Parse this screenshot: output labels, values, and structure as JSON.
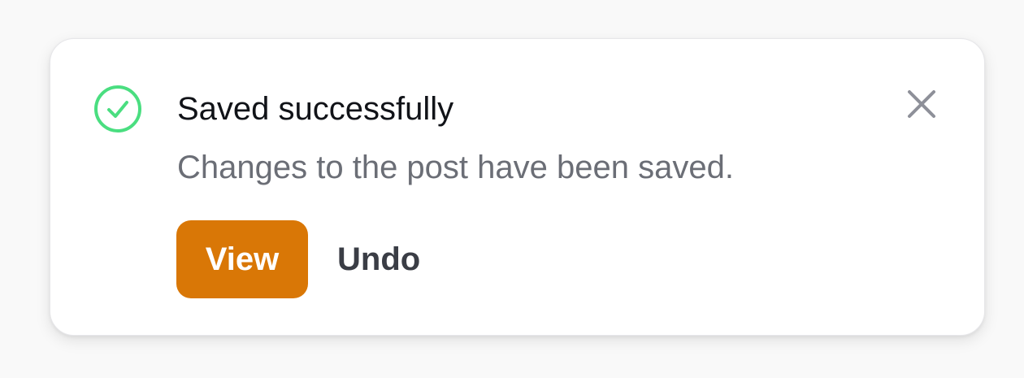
{
  "toast": {
    "title": "Saved successfully",
    "message": "Changes to the post have been saved.",
    "status_icon": "check-circle-icon",
    "close_icon": "close-icon",
    "actions": {
      "view_label": "View",
      "undo_label": "Undo"
    }
  },
  "colors": {
    "success": "#4ade80",
    "primary_button": "#d97706",
    "title_text": "#111318",
    "message_text": "#6b6e76",
    "close_icon": "#8e9099"
  }
}
